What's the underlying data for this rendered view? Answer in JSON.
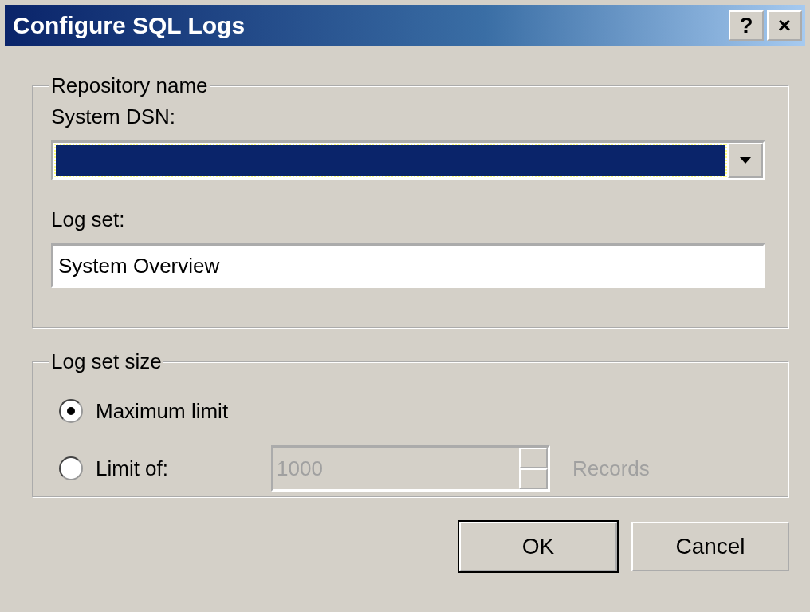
{
  "window": {
    "title": "Configure SQL Logs",
    "title_buttons": [
      "?",
      "×"
    ]
  },
  "repository": {
    "legend": "Repository name",
    "dsn_label": "System DSN:",
    "dsn_dropdown": {
      "focused": true
    },
    "log_set_label": "Log set:",
    "log_set": {
      "value": "System Overview"
    }
  },
  "size": {
    "legend": "Log set size",
    "options": [
      {
        "label": "Maximum limit",
        "selected": true
      },
      {
        "label": "Limit of:",
        "selected": false
      }
    ],
    "limit": {
      "value": "1000",
      "disabled": true
    },
    "unit": {
      "text": "Records",
      "disabled": true
    }
  },
  "buttons": [
    {
      "label": "OK",
      "default": true
    },
    {
      "label": "Cancel",
      "default": false
    }
  ]
}
